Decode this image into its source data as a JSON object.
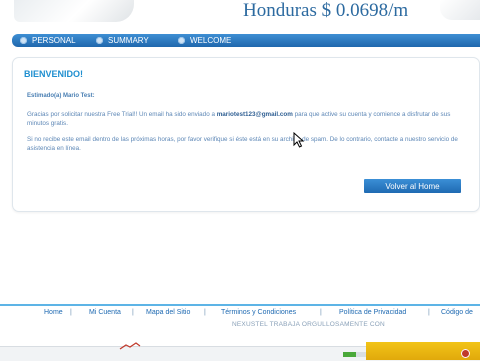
{
  "header": {
    "rate_text": "Honduras $ 0.0698/m"
  },
  "nav": {
    "items": [
      {
        "label": "PERSONAL"
      },
      {
        "label": "SUMMARY"
      },
      {
        "label": "WELCOME"
      }
    ]
  },
  "panel": {
    "title": "BIENVENIDO!",
    "greeting": "Estimado(a) Mario Test:",
    "p1_before": "Gracias por solicitar nuestra Free Trial!! Un email ha sido enviado a ",
    "p1_email": "mariotest123@gmail.com",
    "p1_after": " para que active su cuenta y comience a disfrutar de sus minutos gratis.",
    "p2": "Si no recibe este email dentro de las próximas horas, por favor verifique si éste está en su archivo de spam. De lo contrario, contacte a nuestro servicio de asistencia en línea.",
    "home_button": "Volver al Home"
  },
  "footer": {
    "links": [
      "Home",
      "Mi Cuenta",
      "Mapa del Sitio",
      "Términos y Condiciones",
      "Política de Privacidad",
      "Código de"
    ],
    "separator": "|",
    "note": "NEXUSTEL TRABAJA ORGULLOSAMENTE CON"
  },
  "colors": {
    "accent": "#1f8fd0",
    "nav_blue": "#2a78c2",
    "button_blue": "#2a7cc6",
    "footer_line": "#5db4e6"
  },
  "icons": {
    "nav_dot": "circle-bullet-icon",
    "cursor": "mouse-pointer-icon"
  },
  "page_load_progress": 0.2
}
